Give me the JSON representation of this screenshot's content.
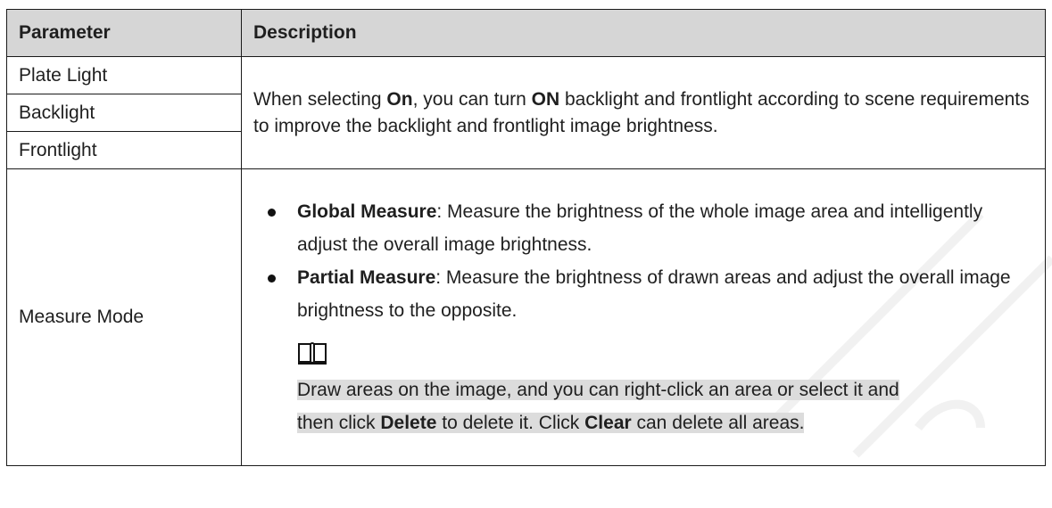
{
  "table": {
    "header": {
      "parameter": "Parameter",
      "description": "Description"
    },
    "rows": [
      {
        "parameter": "Plate Light"
      },
      {
        "parameter": "Backlight"
      },
      {
        "parameter": "Frontlight"
      }
    ],
    "merged_description": {
      "t1": "When selecting ",
      "b1": "On",
      "t2": ", you can turn ",
      "b2": "ON",
      "t3": " backlight and frontlight according to scene requirements to improve the backlight and frontlight image brightness."
    },
    "measure": {
      "parameter": "Measure Mode",
      "bullets": [
        {
          "term": "Global Measure",
          "text": ": Measure the brightness of the whole image area and intelligently adjust the overall image brightness."
        },
        {
          "term": "Partial Measure",
          "text": ": Measure the brightness of drawn areas and adjust the overall image brightness to the opposite."
        }
      ],
      "note_icon": "book-icon",
      "note_line1": "Draw areas on the image, and you can right-click an area or select it and",
      "note_line2_a": "then click ",
      "note_line2_b": "Delete",
      "note_line2_c": " to delete it. Click ",
      "note_line2_d": "Clear",
      "note_line2_e": " can delete all areas."
    }
  },
  "colors": {
    "header_bg": "#d6d6d6",
    "note_highlight": "#dcdcdc",
    "border": "#1a1a1a"
  }
}
